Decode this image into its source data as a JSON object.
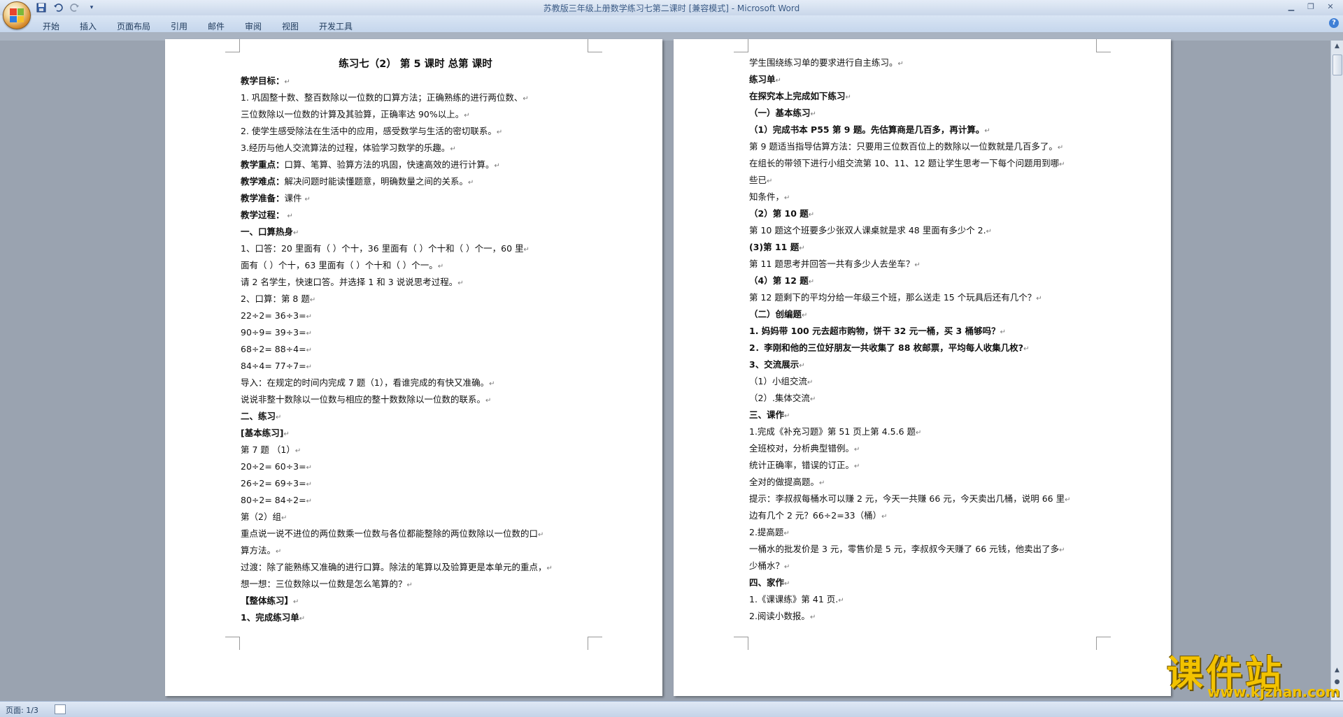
{
  "window": {
    "title": "苏教版三年级上册数学练习七第二课时 [兼容模式] - Microsoft Word"
  },
  "qat": {
    "save_icon": "save-icon",
    "undo_icon": "undo-icon",
    "redo_icon": "redo-icon",
    "customize_icon": "customize-qat-icon"
  },
  "ribbon": {
    "tabs": [
      "开始",
      "插入",
      "页面布局",
      "引用",
      "邮件",
      "审阅",
      "视图",
      "开发工具"
    ]
  },
  "status": {
    "page_indicator": "页面: 1/3"
  },
  "watermark": {
    "brand": "课件站",
    "url": "www.kjzhan.com"
  },
  "page1": {
    "title": "练习七（2）    第 5 课时    总第    课时",
    "lines": [
      {
        "bold_prefix": "教学目标：",
        "text": ""
      },
      {
        "bold_prefix": "",
        "text": "    1.  巩固整十数、整百数除以一位数的口算方法；正确熟练的进行两位数、"
      },
      {
        "bold_prefix": "",
        "text": "三位数除以一位数的计算及其验算，正确率达 90%以上。"
      },
      {
        "bold_prefix": "",
        "text": "    2.  使学生感受除法在生活中的应用，感受数学与生活的密切联系。"
      },
      {
        "bold_prefix": "",
        "text": "    3.经历与他人交流算法的过程，体验学习数学的乐趣。"
      },
      {
        "bold_prefix": "教学重点：",
        "text": "口算、笔算、验算方法的巩固，快速高效的进行计算。"
      },
      {
        "bold_prefix": "教学难点：",
        "text": "解决问题时能读懂题意，明确数量之间的关系。"
      },
      {
        "bold_prefix": "教学准备：",
        "text": "课件    "
      },
      {
        "bold_prefix": "教学过程：",
        "text": "  "
      },
      {
        "bold_prefix": "一、口算热身",
        "text": ""
      },
      {
        "bold_prefix": "",
        "text": "1、口答：20 里面有（    ）个十，36 里面有（    ）个十和（    ）个一，60 里"
      },
      {
        "bold_prefix": "",
        "text": "面有（    ）个十，63 里面有（    ）个十和（    ）个一。"
      },
      {
        "bold_prefix": "",
        "text": "请 2 名学生，快速口答。并选择 1 和 3 说说思考过程。"
      },
      {
        "bold_prefix": "",
        "text": "2、口算：第 8 题"
      },
      {
        "bold_prefix": "",
        "text": "22÷2=     36÷3="
      },
      {
        "bold_prefix": "",
        "text": "90÷9=     39÷3="
      },
      {
        "bold_prefix": "",
        "text": "68÷2=     88÷4="
      },
      {
        "bold_prefix": "",
        "text": "84÷4=     77÷7="
      },
      {
        "bold_prefix": "",
        "text": "导入：在规定的时间内完成 7 题（1），看谁完成的有快又准确。"
      },
      {
        "bold_prefix": "",
        "text": "说说非整十数除以一位数与相应的整十数数除以一位数的联系。"
      },
      {
        "bold_prefix": "二、练习",
        "text": ""
      },
      {
        "bold_prefix": "[基本练习]",
        "text": ""
      },
      {
        "bold_prefix": "",
        "text": "第 7 题 （1）"
      },
      {
        "bold_prefix": "",
        "text": "20÷2=      60÷3="
      },
      {
        "bold_prefix": "",
        "text": "26÷2=     69÷3="
      },
      {
        "bold_prefix": "",
        "text": "80÷2=    84÷2="
      },
      {
        "bold_prefix": "",
        "text": "第（2）组"
      },
      {
        "bold_prefix": "",
        "text": "重点说一说不进位的两位数乘一位数与各位都能整除的两位数除以一位数的口"
      },
      {
        "bold_prefix": "",
        "text": "算方法。"
      },
      {
        "bold_prefix": "",
        "text": "过渡：除了能熟练又准确的进行口算。除法的笔算以及验算更是本单元的重点，"
      },
      {
        "bold_prefix": "",
        "text": "想一想：三位数除以一位数是怎么笔算的？"
      },
      {
        "bold_prefix": "【整体练习】",
        "text": ""
      },
      {
        "bold_prefix": "1、完成练习单",
        "text": ""
      }
    ]
  },
  "page2": {
    "lines": [
      {
        "bold_prefix": "",
        "text": "学生围绕练习单的要求进行自主练习。"
      },
      {
        "bold_prefix": "练习单",
        "text": ""
      },
      {
        "bold_prefix": "在探究本上完成如下练习",
        "text": ""
      },
      {
        "bold_prefix": "（一）基本练习",
        "text": ""
      },
      {
        "bold_prefix": "（1）完成书本 P55 第 9 题。先估算商是几百多，再计算。",
        "text": ""
      },
      {
        "bold_prefix": "",
        "text": "第 9 题适当指导估算方法：只要用三位数百位上的数除以一位数就是几百多了。"
      },
      {
        "bold_prefix": "",
        "text": "在组长的带领下进行小组交流第 10、11、12 题让学生思考一下每个问题用到哪"
      },
      {
        "bold_prefix": "",
        "text": "  些已"
      },
      {
        "bold_prefix": "",
        "text": "知条件，"
      },
      {
        "bold_prefix": "（2）第 10 题",
        "text": ""
      },
      {
        "bold_prefix": "",
        "text": "第 10 题这个班要多少张双人课桌就是求 48 里面有多少个 2."
      },
      {
        "bold_prefix": " (3)第 11 题",
        "text": ""
      },
      {
        "bold_prefix": "",
        "text": "第 11 题思考并回答一共有多少人去坐车？"
      },
      {
        "bold_prefix": "（4）第 12 题",
        "text": ""
      },
      {
        "bold_prefix": "",
        "text": "第 12 题剩下的平均分给一年级三个班，那么送走 15 个玩具后还有几个？"
      },
      {
        "bold_prefix": "（二）创编题",
        "text": ""
      },
      {
        "bold_prefix": "1. 妈妈带 100 元去超市购物，饼干 32 元一桶，买 3 桶够吗？",
        "text": ""
      },
      {
        "bold_prefix": "2．李刚和他的三位好朋友一共收集了 88 枚邮票，平均每人收集几枚?",
        "text": ""
      },
      {
        "bold_prefix": "3、交流展示",
        "text": ""
      },
      {
        "bold_prefix": "",
        "text": "（1）小组交流"
      },
      {
        "bold_prefix": "",
        "text": "（2）.集体交流"
      },
      {
        "bold_prefix": "三、课作",
        "text": ""
      },
      {
        "bold_prefix": "",
        "text": "1.完成《补充习题》第 51 页上第 4.5.6 题"
      },
      {
        "bold_prefix": "",
        "text": "全班校对，分析典型错例。"
      },
      {
        "bold_prefix": "",
        "text": "统计正确率，错误的订正。"
      },
      {
        "bold_prefix": "",
        "text": "全对的做提高题。"
      },
      {
        "bold_prefix": "",
        "text": "提示：李叔叔每桶水可以赚 2 元，今天一共赚 66 元，今天卖出几桶，说明 66 里"
      },
      {
        "bold_prefix": "",
        "text": "边有几个 2 元？66÷2=33（桶）"
      },
      {
        "bold_prefix": "",
        "text": "2.提高题"
      },
      {
        "bold_prefix": "",
        "text": "一桶水的批发价是 3 元，零售价是 5 元，李叔叔今天赚了 66 元钱，他卖出了多"
      },
      {
        "bold_prefix": "",
        "text": "少桶水？"
      },
      {
        "bold_prefix": "四、家作",
        "text": ""
      },
      {
        "bold_prefix": "",
        "text": "1.《课课练》第 41 页."
      },
      {
        "bold_prefix": "",
        "text": "2.阅读小数报。"
      }
    ]
  }
}
